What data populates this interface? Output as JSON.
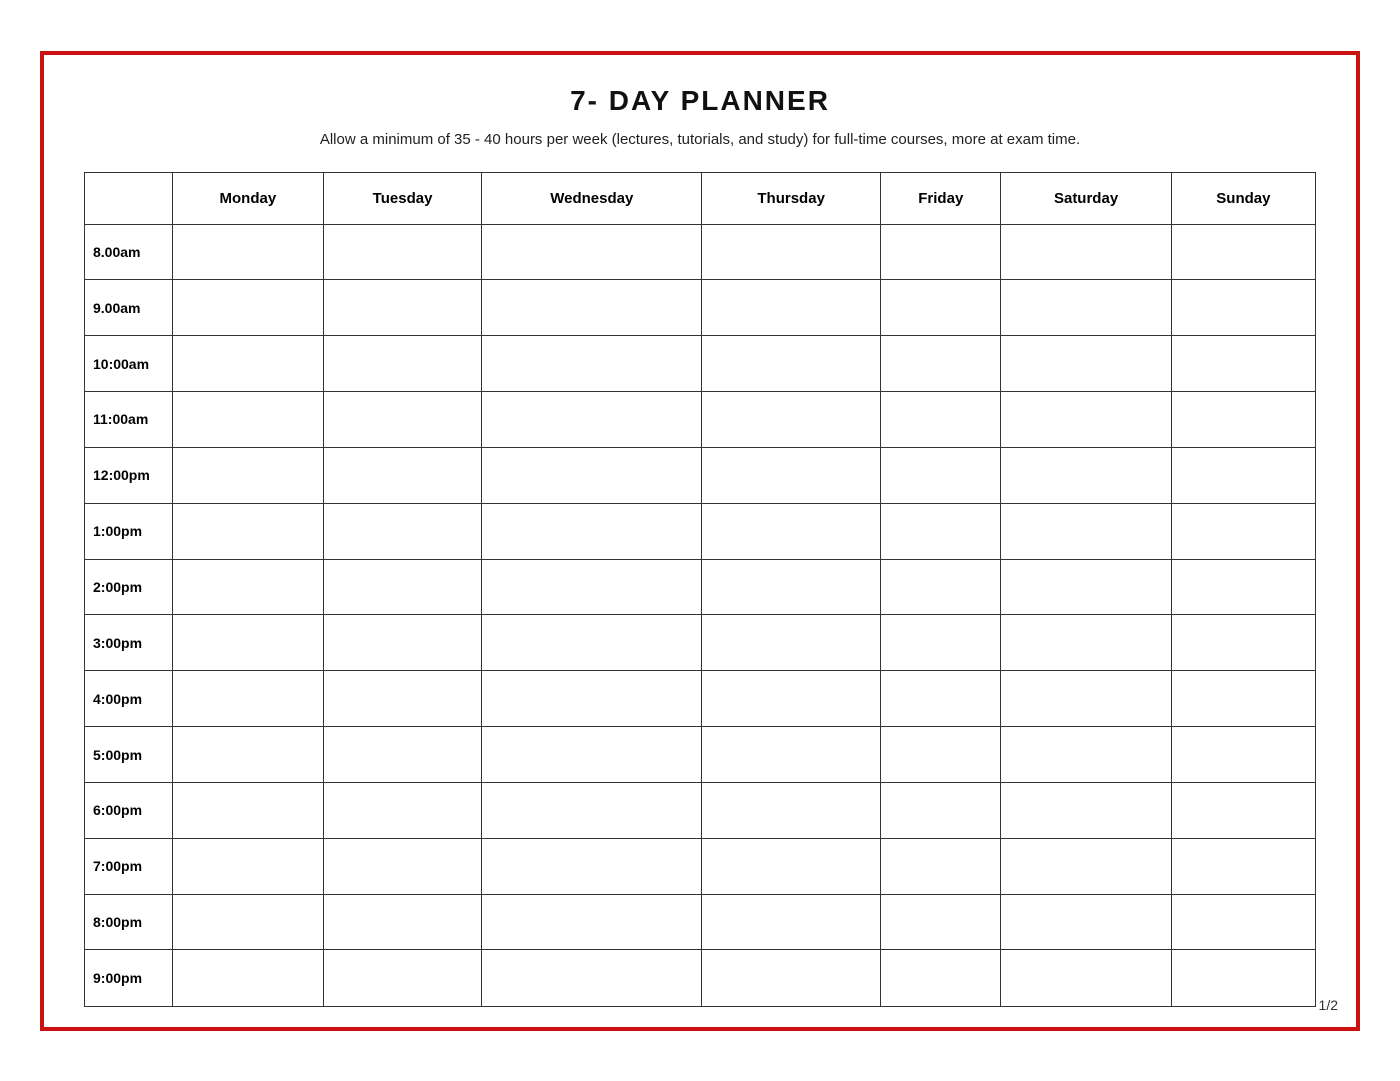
{
  "page": {
    "title": "7- DAY PLANNER",
    "subtitle": "Allow a minimum of 35 - 40 hours per week (lectures, tutorials, and study) for full-time courses, more at exam time.",
    "page_number": "1/2"
  },
  "table": {
    "headers": [
      "",
      "Monday",
      "Tuesday",
      "Wednesday",
      "Thursday",
      "Friday",
      "Saturday",
      "Sunday"
    ],
    "time_slots": [
      "8.00am",
      "9.00am",
      "10:00am",
      "11:00am",
      "12:00pm",
      "1:00pm",
      "2:00pm",
      "3:00pm",
      "4:00pm",
      "5:00pm",
      "6:00pm",
      "7:00pm",
      "8:00pm",
      "9:00pm"
    ]
  }
}
